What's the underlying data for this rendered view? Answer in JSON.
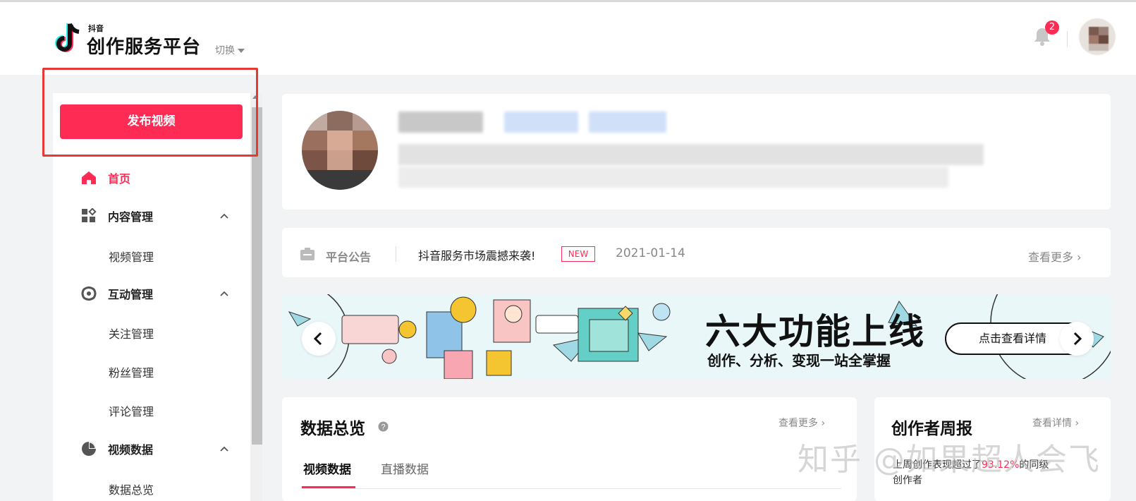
{
  "header": {
    "logo_sub": "抖音",
    "logo_title": "创作服务平台",
    "switch_label": "切换",
    "notification_count": "2"
  },
  "sidebar": {
    "publish_label": "发布视频",
    "items": [
      {
        "label": "首页",
        "icon": "home-icon",
        "active": true
      },
      {
        "label": "内容管理",
        "icon": "grid-icon",
        "expanded": true
      },
      {
        "label": "视频管理",
        "sub": true
      },
      {
        "label": "互动管理",
        "icon": "interaction-icon",
        "expanded": true
      },
      {
        "label": "关注管理",
        "sub": true
      },
      {
        "label": "粉丝管理",
        "sub": true
      },
      {
        "label": "评论管理",
        "sub": true
      },
      {
        "label": "视频数据",
        "icon": "pie-chart-icon",
        "expanded": true
      },
      {
        "label": "数据总览",
        "sub": true
      }
    ]
  },
  "announcement": {
    "label": "平台公告",
    "title": "抖音服务市场震撼来袭!",
    "badge": "NEW",
    "date": "2021-01-14",
    "more": "查看更多"
  },
  "banner": {
    "title": "六大功能上线",
    "subtitle": "创作、分析、变现一站全掌握",
    "button": "点击查看详情"
  },
  "data_overview": {
    "title": "数据总览",
    "more": "查看更多",
    "tabs": [
      "视频数据",
      "直播数据"
    ],
    "active_tab": 0
  },
  "weekly": {
    "title": "创作者周报",
    "more": "查看详情",
    "text_before": "上周创作表现超过了",
    "percent": "93.12%",
    "text_after": "的同级",
    "text_line2": "创作者"
  },
  "watermark": "知乎 @如果超人会飞",
  "colors": {
    "accent": "#fe2c55",
    "highlight_box": "#e53935",
    "background": "#f2f3f5"
  }
}
